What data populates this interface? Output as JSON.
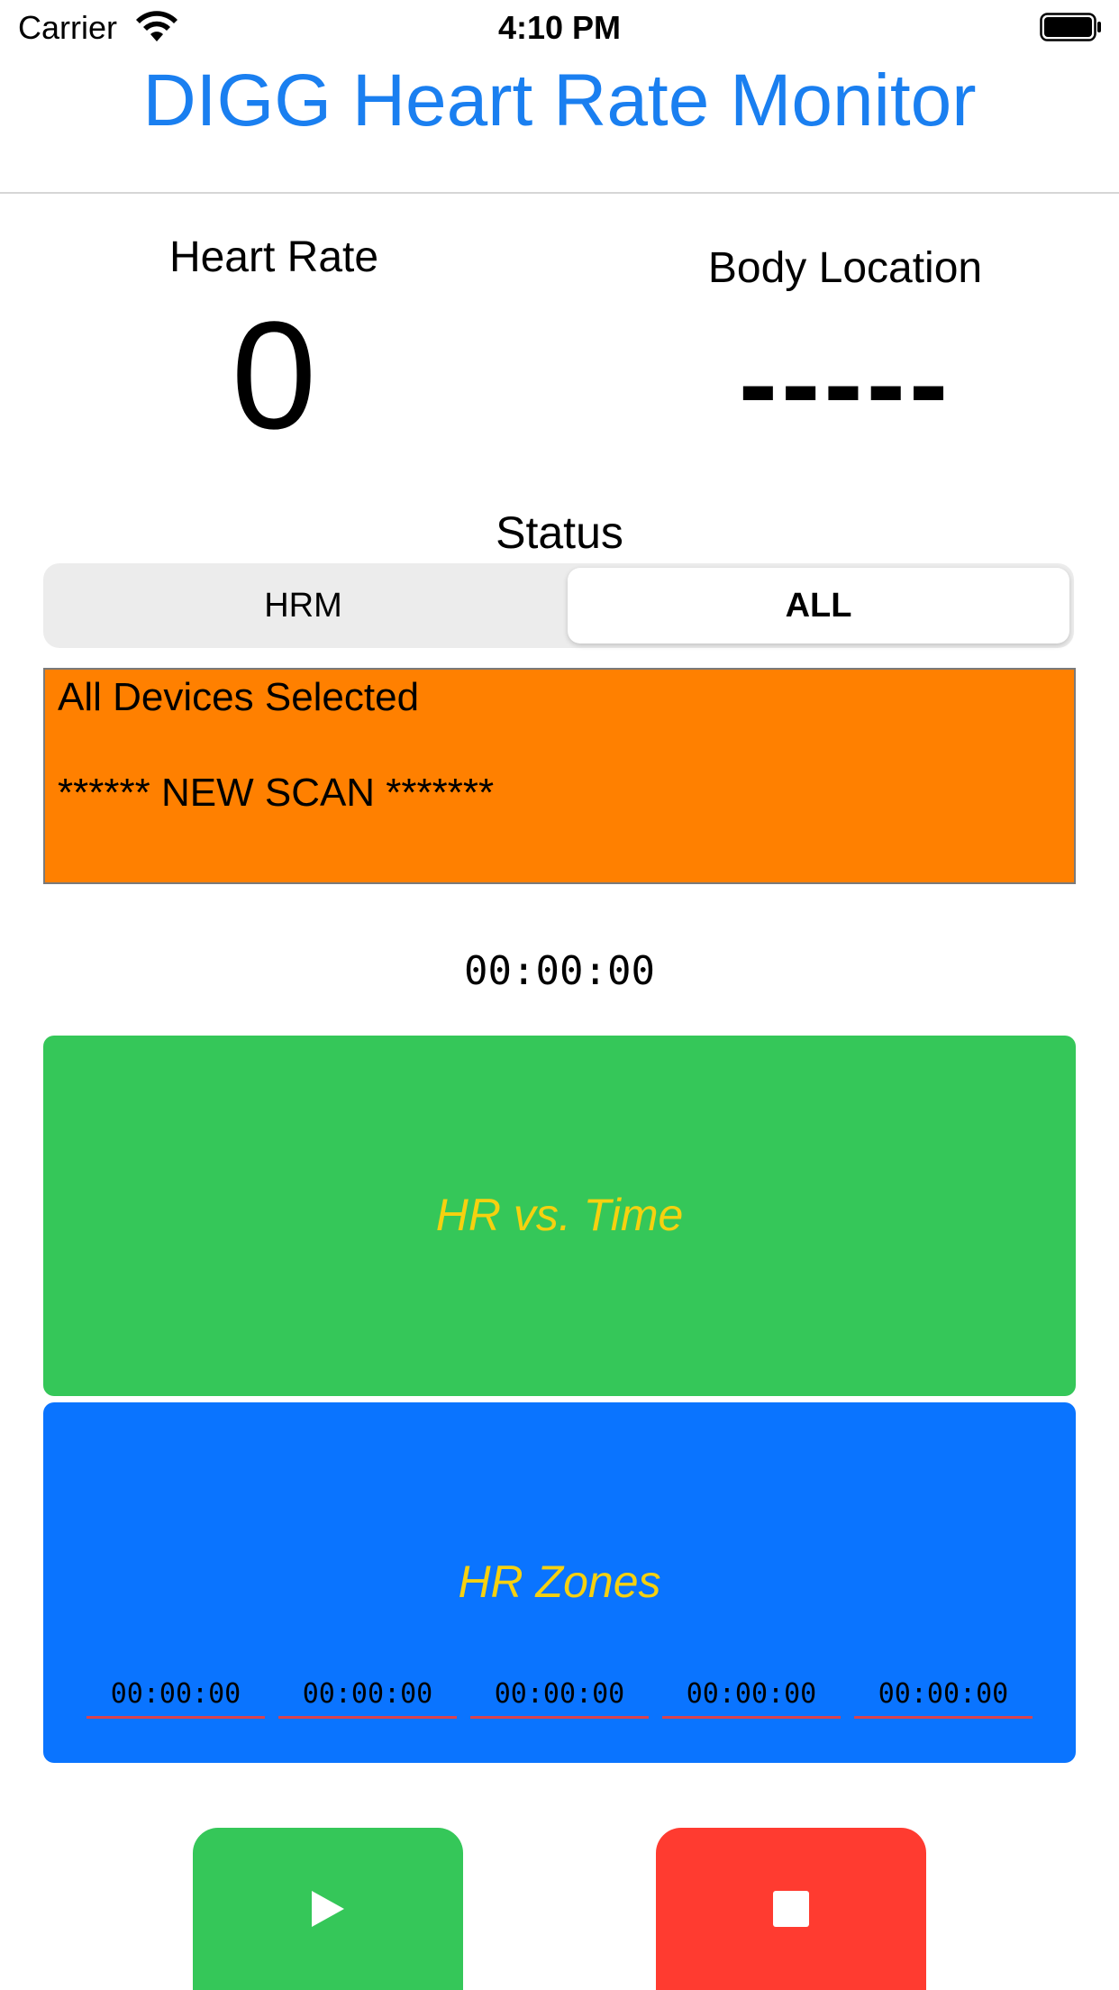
{
  "status_bar": {
    "carrier": "Carrier",
    "time": "4:10 PM",
    "wifi_icon": "wifi-icon",
    "battery_icon": "battery-icon"
  },
  "app": {
    "title": "DIGG Heart Rate Monitor",
    "title_color": "#1a7ff0"
  },
  "heart_rate": {
    "label": "Heart Rate",
    "value": "0"
  },
  "body_location": {
    "label": "Body Location",
    "value": "-----"
  },
  "status": {
    "label": "Status",
    "segments": [
      "HRM",
      "ALL"
    ],
    "selected": "ALL",
    "box_color": "#ff8000",
    "lines": [
      "All Devices Selected",
      "****** NEW SCAN *******"
    ]
  },
  "timer": "00:00:00",
  "panels": {
    "hr_vs_time": {
      "title": "HR vs. Time",
      "color": "#35c759"
    },
    "hr_zones": {
      "title": "HR Zones",
      "color": "#0a74ff",
      "zones": [
        "00:00:00",
        "00:00:00",
        "00:00:00",
        "00:00:00",
        "00:00:00"
      ]
    }
  },
  "controls": {
    "play": {
      "icon": "play-icon",
      "color": "#35c759"
    },
    "stop": {
      "icon": "stop-icon",
      "color": "#ff3b30"
    }
  }
}
